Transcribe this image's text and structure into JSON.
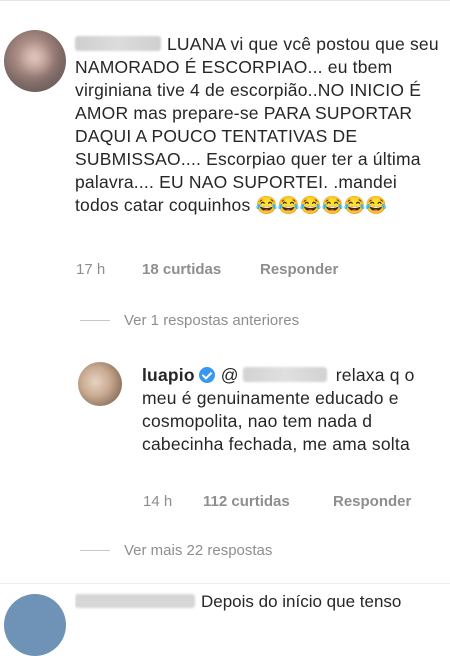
{
  "comment1": {
    "text": "LUANA vi que vcê postou que seu NAMORADO É ESCORPIAO... eu tbem virginiana tive 4 de escorpião..NO INICIO É AMOR mas prepare-se PARA SUPORTAR DAQUI A POUCO TENTATIVAS DE SUBMISSAO.... Escorpiao quer ter a última palavra.... EU NAO SUPORTEI. .mandei todos catar coquinhos 😂😂😂😂😂😂",
    "time": "17 h",
    "likes": "18 curtidas",
    "reply": "Responder"
  },
  "replies_toggle_1": "Ver 1 respostas anteriores",
  "comment2": {
    "username": "luapio",
    "mention_prefix": "@",
    "text": "relaxa q o meu é genuinamente educado e cosmopolita, nao tem nada d cabecinha fechada, me ama solta",
    "time": "14 h",
    "likes": "112 curtidas",
    "reply": "Responder"
  },
  "replies_toggle_2": "Ver mais 22 respostas",
  "next_comment": {
    "text": "Depois do início que tenso"
  },
  "colors": {
    "text": "#262626",
    "meta": "#8e8e8e",
    "verified": "#3897f0"
  },
  "icons": [
    "verified-icon"
  ]
}
